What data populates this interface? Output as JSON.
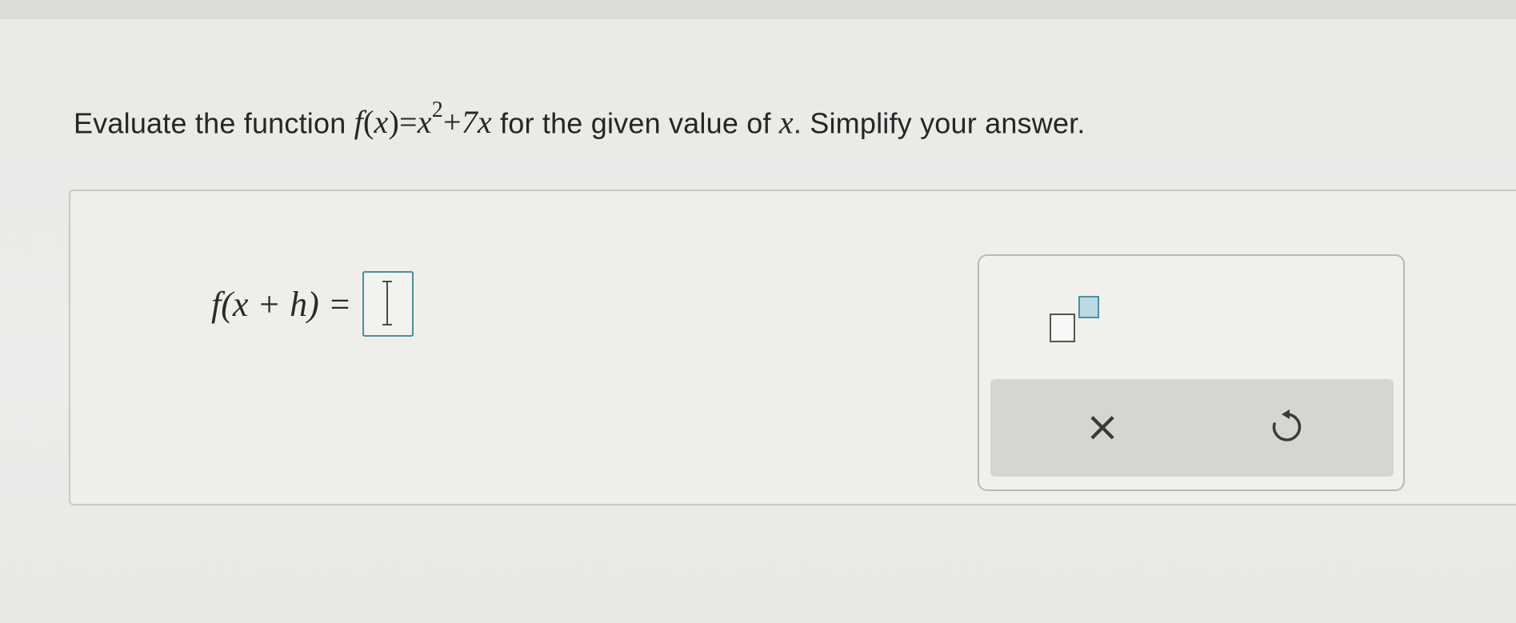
{
  "question": {
    "prefix": "Evaluate the function ",
    "function": {
      "name": "f",
      "open_paren": "(",
      "var": "x",
      "close_paren": ")",
      "equals": "=",
      "term1_base": "x",
      "term1_exp": "2",
      "plus": "+",
      "term2": "7x"
    },
    "middle": " for the given value of ",
    "given_var": "x",
    "suffix": ". Simplify your answer."
  },
  "answer": {
    "lhs": "f(x + h) =",
    "value": ""
  },
  "keypad": {
    "clear_symbol": "×"
  },
  "colors": {
    "accent": "#4a8fa3",
    "accent_fill": "#b9dbe6",
    "action_bar": "#d6d5d2"
  },
  "icons": {
    "exponent": "exponent-template-icon",
    "clear": "close-icon",
    "reset": "undo-icon"
  }
}
